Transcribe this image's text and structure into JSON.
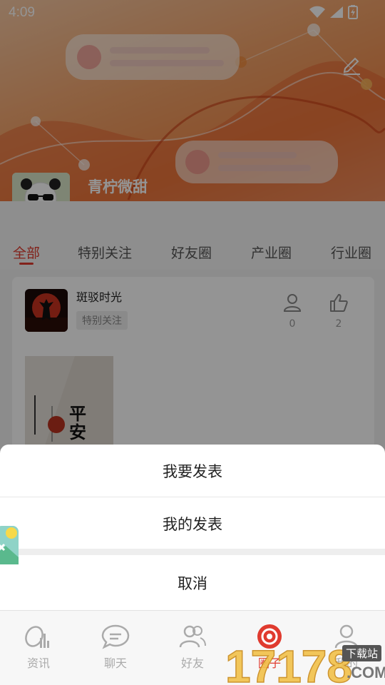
{
  "status": {
    "time": "4:09"
  },
  "profile": {
    "name": "青柠微甜"
  },
  "tabs": [
    "全部",
    "特别关注",
    "好友圈",
    "产业圈",
    "行业圈"
  ],
  "post": {
    "author": "斑驳时光",
    "tag": "特别关注",
    "followers": "0",
    "likes": "2",
    "image_text": "平安"
  },
  "sheet": {
    "publish": "我要发表",
    "my_posts": "我的发表",
    "cancel": "取消"
  },
  "bottom_nav": {
    "news": "资讯",
    "chat": "聊天",
    "friends": "好友",
    "circle": "圈子",
    "mine": "我的"
  },
  "watermark": {
    "label": "下载站",
    "number": "17178",
    "domain": ".COM"
  },
  "colors": {
    "accent": "#e03b2f",
    "header": "#f08a4a"
  }
}
